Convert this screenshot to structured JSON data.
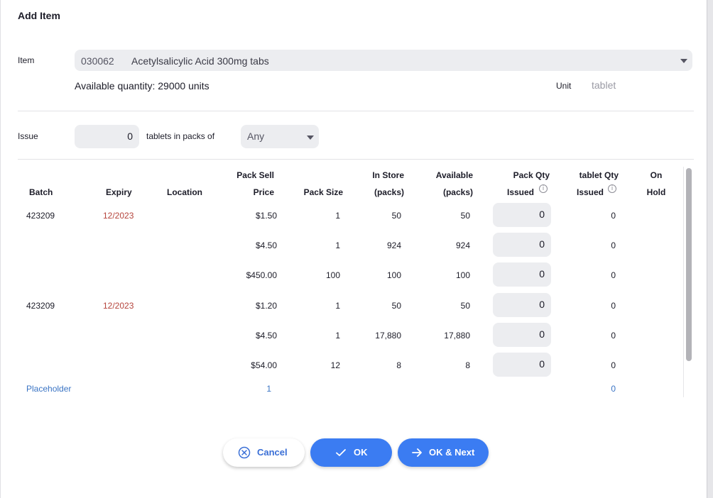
{
  "dialog": {
    "title": "Add Item"
  },
  "form": {
    "item_label": "Item",
    "item_code": "030062",
    "item_name": "Acetylsalicylic Acid 300mg tabs",
    "available_quantity": "Available quantity: 29000 units",
    "unit_label": "Unit",
    "unit_value": "tablet",
    "issue_label": "Issue",
    "issue_quantity": "0",
    "issue_unit_text": "tablets in packs of",
    "pack_size_selected": "Any"
  },
  "table": {
    "headers": {
      "batch": "Batch",
      "expiry": "Expiry",
      "location": "Location",
      "pack_sell_line1": "Pack Sell",
      "pack_sell_line2": "Price",
      "pack_size": "Pack Size",
      "in_store_line1": "In Store",
      "in_store_line2": "(packs)",
      "available_line1": "Available",
      "available_line2": "(packs)",
      "pack_qty_line1": "Pack Qty",
      "pack_qty_line2": "Issued",
      "unit_qty_line1": "tablet Qty",
      "unit_qty_line2": "Issued",
      "on_hold_line1": "On",
      "on_hold_line2": "Hold"
    },
    "rows": [
      {
        "batch": "423209",
        "expiry": "12/2023",
        "price": "$1.50",
        "pack_size": "1",
        "in_store": "50",
        "available": "50",
        "pack_qty": "0",
        "unit_qty": "0"
      },
      {
        "batch": "",
        "expiry": "",
        "price": "$4.50",
        "pack_size": "1",
        "in_store": "924",
        "available": "924",
        "pack_qty": "0",
        "unit_qty": "0"
      },
      {
        "batch": "",
        "expiry": "",
        "price": "$450.00",
        "pack_size": "100",
        "in_store": "100",
        "available": "100",
        "pack_qty": "0",
        "unit_qty": "0"
      },
      {
        "batch": "423209",
        "expiry": "12/2023",
        "price": "$1.20",
        "pack_size": "1",
        "in_store": "50",
        "available": "50",
        "pack_qty": "0",
        "unit_qty": "0"
      },
      {
        "batch": "",
        "expiry": "",
        "price": "$4.50",
        "pack_size": "1",
        "in_store": "17,880",
        "available": "17,880",
        "pack_qty": "0",
        "unit_qty": "0"
      },
      {
        "batch": "",
        "expiry": "",
        "price": "$54.00",
        "pack_size": "12",
        "in_store": "8",
        "available": "8",
        "pack_qty": "0",
        "unit_qty": "0"
      }
    ],
    "placeholder_row": {
      "batch": "Placeholder",
      "pack_size": "1",
      "unit_qty": "0"
    }
  },
  "buttons": {
    "cancel": "Cancel",
    "ok": "OK",
    "ok_next": "OK & Next"
  },
  "colors": {
    "accent": "#3b7cf2",
    "expiry_warning": "#b5443c",
    "placeholder": "#3a74c4"
  },
  "icons": {
    "info": "info-icon",
    "cancel": "x-circle-icon",
    "ok": "check-icon",
    "next": "arrow-right-icon",
    "dropdown": "chevron-down-icon"
  }
}
